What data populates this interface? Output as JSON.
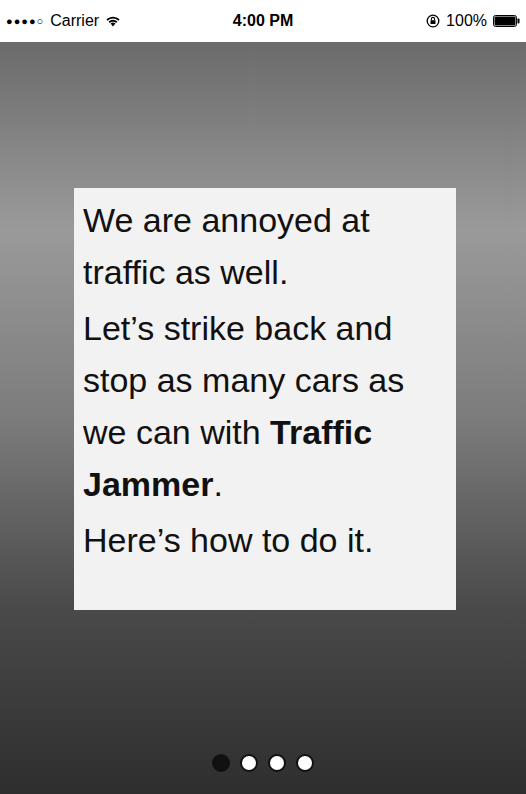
{
  "status_bar": {
    "signal": "●●●●○",
    "carrier": "Carrier",
    "time": "4:00 PM",
    "battery": "100%",
    "battery_level": 1.0
  },
  "background": {
    "kind": "photo"
  },
  "card": {
    "paragraphs": [
      [
        {
          "text": "We are annoyed at traffic as well.",
          "bold": false
        }
      ],
      [
        {
          "text": "Let’s strike back and stop as many cars as we can with ",
          "bold": false
        },
        {
          "text": "Traffic Jammer",
          "bold": true
        },
        {
          "text": ".",
          "bold": false
        }
      ],
      [
        {
          "text": "Here’s how to do it.",
          "bold": false
        }
      ]
    ]
  },
  "page_dots": [
    {
      "selected": true
    },
    {
      "selected": false
    },
    {
      "selected": false
    },
    {
      "selected": false
    }
  ]
}
